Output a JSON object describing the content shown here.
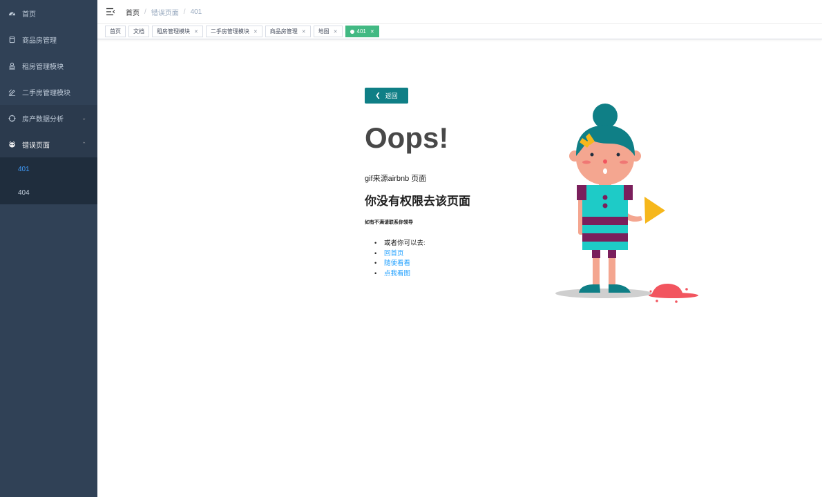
{
  "sidebar": {
    "items": [
      {
        "label": "首页",
        "icon": "dashboard-icon"
      },
      {
        "label": "商品房管理",
        "icon": "cup-icon"
      },
      {
        "label": "租房管理模块",
        "icon": "person-icon"
      },
      {
        "label": "二手房管理模块",
        "icon": "edit-icon"
      },
      {
        "label": "房产数据分析",
        "icon": "target-icon"
      },
      {
        "label": "错误页面",
        "icon": "bug-icon"
      }
    ],
    "error_submenu": [
      {
        "label": "401",
        "active": true
      },
      {
        "label": "404",
        "active": false
      }
    ]
  },
  "breadcrumb": {
    "home": "首页",
    "parent": "错误页面",
    "current": "401",
    "separator": "/"
  },
  "tags": [
    {
      "label": "首页",
      "closable": false
    },
    {
      "label": "文档",
      "closable": false
    },
    {
      "label": "租房管理模块",
      "closable": true
    },
    {
      "label": "二手房管理模块",
      "closable": true
    },
    {
      "label": "商品房管理",
      "closable": true
    },
    {
      "label": "地图",
      "closable": true
    },
    {
      "label": "401",
      "closable": true,
      "active": true
    }
  ],
  "error_page": {
    "back_label": "返回",
    "title": "Oops!",
    "gif_source": "gif来源airbnb 页面",
    "headline": "你没有权限去该页面",
    "hint": "如有不满请联系你领导",
    "intro": "或者你可以去:",
    "links": [
      "回首页",
      "随便看看",
      "点我看图"
    ]
  },
  "colors": {
    "sidebar_bg": "#304156",
    "submenu_bg": "#1f2d3d",
    "active_link": "#409eff",
    "active_tag": "#42b983",
    "back_button": "#0f7f86"
  }
}
